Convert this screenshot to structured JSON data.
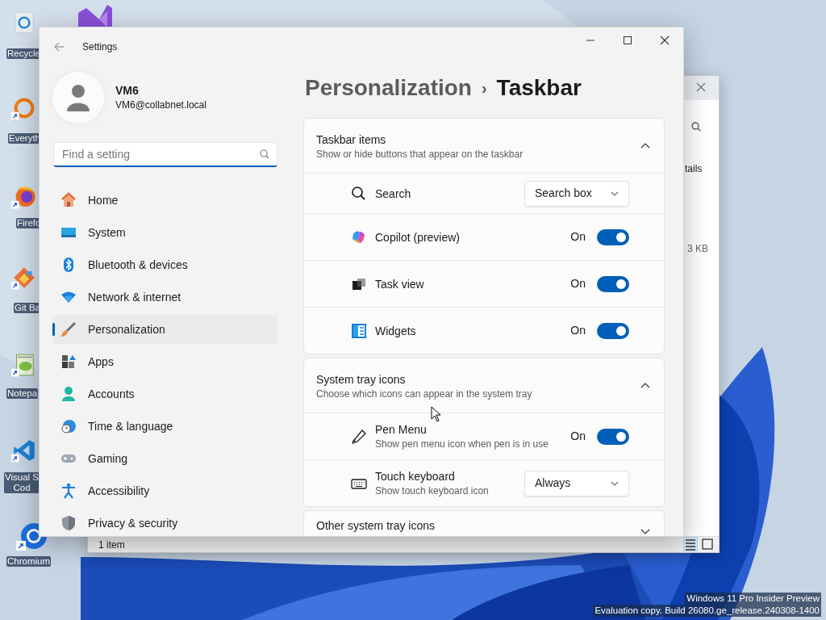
{
  "desktop": {
    "icons": [
      {
        "label": "Recycle"
      },
      {
        "label": "Everyth"
      },
      {
        "label": "Firefo"
      },
      {
        "label": "Git Ba"
      },
      {
        "label": "Notepa"
      },
      {
        "label": "Visual S\nCod"
      },
      {
        "label": "Chromium"
      }
    ],
    "watermark": [
      "Windows 11 Pro Insider Preview",
      "Evaluation copy. Build 26080.ge_release.240308-1400"
    ]
  },
  "background_window": {
    "toolbar_text": "tails",
    "file_size": "3 KB",
    "status_bar": "1 item",
    "view_buttons": [
      {
        "selected": true
      },
      {
        "selected": false
      }
    ]
  },
  "settings": {
    "title": "Settings",
    "user": {
      "name": "VM6",
      "email": "VM6@collabnet.local"
    },
    "search": {
      "placeholder": "Find a setting"
    },
    "nav": [
      {
        "label": "Home",
        "selected": false
      },
      {
        "label": "System",
        "selected": false
      },
      {
        "label": "Bluetooth & devices",
        "selected": false
      },
      {
        "label": "Network & internet",
        "selected": false
      },
      {
        "label": "Personalization",
        "selected": true
      },
      {
        "label": "Apps",
        "selected": false
      },
      {
        "label": "Accounts",
        "selected": false
      },
      {
        "label": "Time & language",
        "selected": false
      },
      {
        "label": "Gaming",
        "selected": false
      },
      {
        "label": "Accessibility",
        "selected": false
      },
      {
        "label": "Privacy & security",
        "selected": false
      }
    ],
    "breadcrumb": {
      "parent": "Personalization",
      "separator": "›",
      "current": "Taskbar"
    },
    "sections": [
      {
        "title": "Taskbar items",
        "subtitle": "Show or hide buttons that appear on the taskbar",
        "expanded": true,
        "items": [
          {
            "kind": "dropdown",
            "label": "Search",
            "value": "Search box"
          },
          {
            "kind": "toggle",
            "label": "Copilot (preview)",
            "on": true,
            "state_label": "On"
          },
          {
            "kind": "toggle",
            "label": "Task view",
            "on": true,
            "state_label": "On"
          },
          {
            "kind": "toggle",
            "label": "Widgets",
            "on": true,
            "state_label": "On"
          }
        ]
      },
      {
        "title": "System tray icons",
        "subtitle": "Choose which icons can appear in the system tray",
        "expanded": true,
        "items": [
          {
            "kind": "toggle",
            "label": "Pen Menu",
            "description": "Show pen menu icon when pen is in use",
            "on": true,
            "state_label": "On"
          },
          {
            "kind": "dropdown",
            "label": "Touch keyboard",
            "description": "Show touch keyboard icon",
            "value": "Always"
          }
        ]
      },
      {
        "title": "Other system tray icons",
        "expanded": false
      }
    ]
  }
}
